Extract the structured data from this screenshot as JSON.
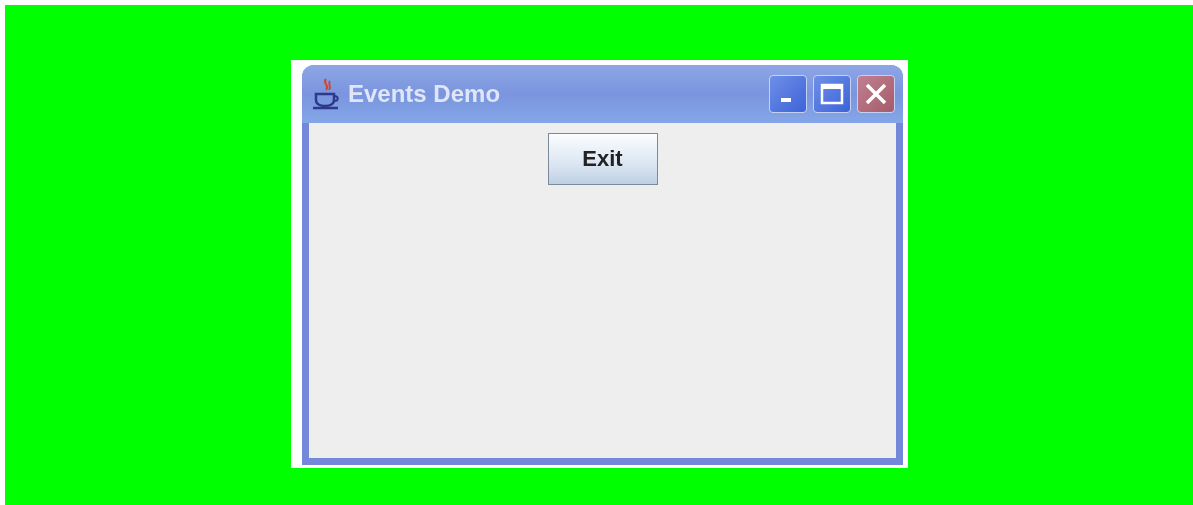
{
  "window": {
    "title": "Events Demo"
  },
  "buttons": [
    {
      "label": "Exit"
    }
  ]
}
